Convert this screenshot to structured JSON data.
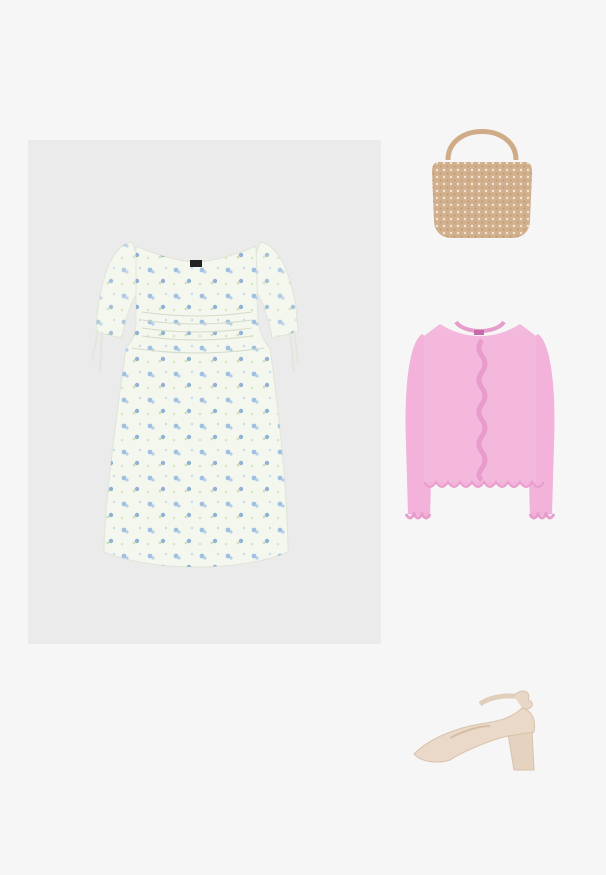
{
  "outfit": {
    "items": [
      {
        "name": "floral-dress",
        "color": "#f4f7ee",
        "accent": "#8fb2d6"
      },
      {
        "name": "beaded-handbag",
        "color": "#d2b08d",
        "accent": "#f2e6d6"
      },
      {
        "name": "pink-cardigan",
        "color": "#f4b8dd",
        "accent": "#e89ccc"
      },
      {
        "name": "ankle-strap-pump",
        "color": "#e8d7c6",
        "accent": "#d9c2ab"
      }
    ],
    "background": "#f6f6f6",
    "panel_color": "#ebebeb"
  }
}
